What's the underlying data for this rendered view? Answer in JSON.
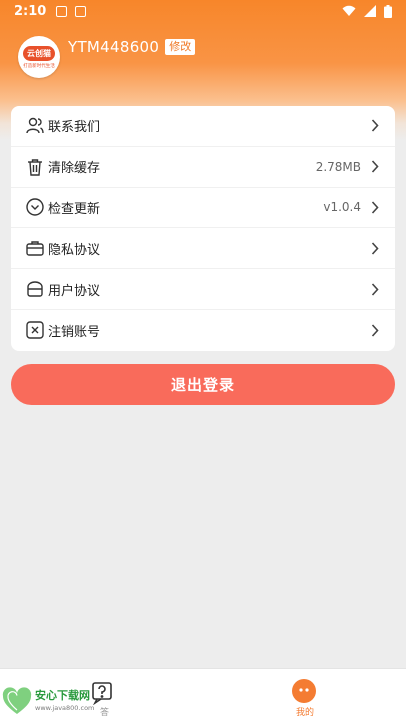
{
  "status_bar": {
    "time": "2:10"
  },
  "profile": {
    "avatar_logo": "云创猫",
    "avatar_slogan": "打造新时代生活",
    "username": "YTM448600",
    "edit_label": "修改"
  },
  "menu": {
    "items": [
      {
        "label": "联系我们",
        "value": "",
        "icon": "contact-icon"
      },
      {
        "label": "清除缓存",
        "value": "2.78MB",
        "icon": "trash-icon"
      },
      {
        "label": "检查更新",
        "value": "v1.0.4",
        "icon": "update-icon"
      },
      {
        "label": "隐私协议",
        "value": "",
        "icon": "privacy-icon"
      },
      {
        "label": "用户协议",
        "value": "",
        "icon": "user-agreement-icon"
      },
      {
        "label": "注销账号",
        "value": "",
        "icon": "cancel-account-icon"
      }
    ]
  },
  "logout_label": "退出登录",
  "tabbar": {
    "help_label": "答",
    "mine_label": "我的",
    "watermark_title": "安心下载网",
    "watermark_url": "www.java800.com"
  },
  "colors": {
    "accent": "#f47c32",
    "logout": "#f96b5b"
  }
}
